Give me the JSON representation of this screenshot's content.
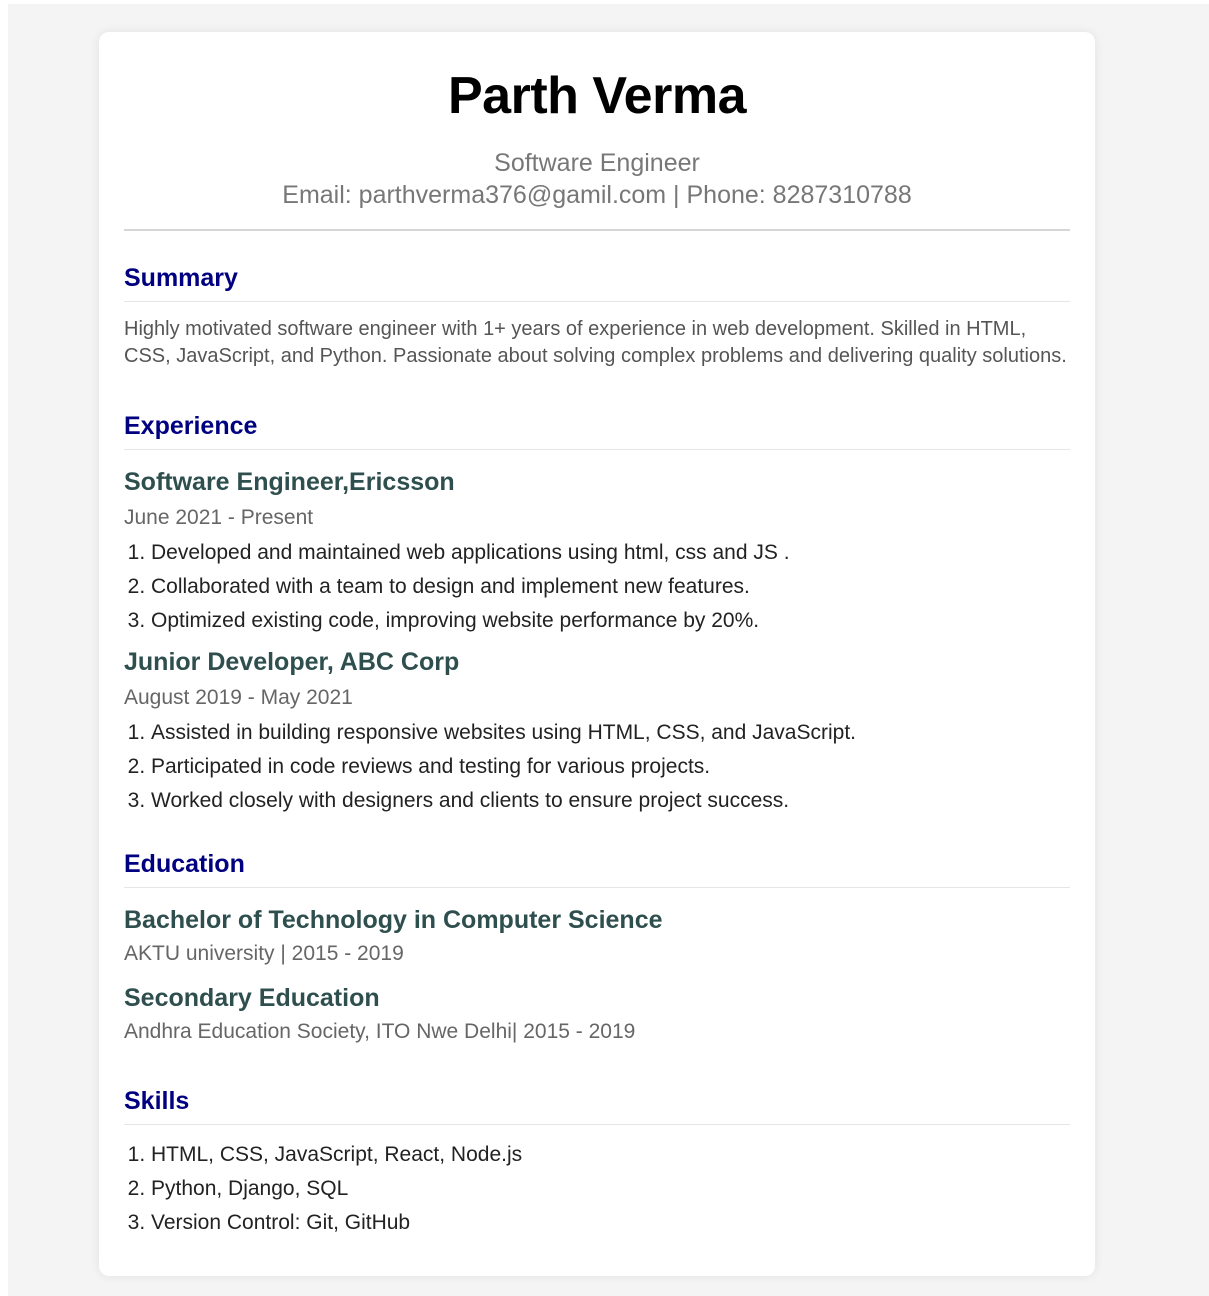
{
  "header": {
    "name": "Parth Verma",
    "role": "Software Engineer",
    "contact": "Email: parthverma376@gamil.com | Phone: 8287310788"
  },
  "summary": {
    "title": "Summary",
    "text": "Highly motivated software engineer with 1+ years of experience in web development. Skilled in HTML, CSS, JavaScript, and Python. Passionate about solving complex problems and delivering quality solutions."
  },
  "experience": {
    "title": "Experience",
    "jobs": [
      {
        "title": "Software Engineer,Ericsson",
        "dates": "June 2021 - Present",
        "items": [
          "Developed and maintained web applications using html, css and JS .",
          "Collaborated with a team to design and implement new features.",
          "Optimized existing code, improving website performance by 20%."
        ]
      },
      {
        "title": "Junior Developer, ABC Corp",
        "dates": "August 2019 - May 2021",
        "items": [
          "Assisted in building responsive websites using HTML, CSS, and JavaScript.",
          "Participated in code reviews and testing for various projects.",
          "Worked closely with designers and clients to ensure project success."
        ]
      }
    ]
  },
  "education": {
    "title": "Education",
    "entries": [
      {
        "title": "Bachelor of Technology in Computer Science",
        "detail": "AKTU university | 2015 - 2019"
      },
      {
        "title": "Secondary Education",
        "detail": "Andhra Education Society, ITO Nwe Delhi| 2015 - 2019"
      }
    ]
  },
  "skills": {
    "title": "Skills",
    "items": [
      "HTML, CSS, JavaScript, React, Node.js",
      "Python, Django, SQL",
      "Version Control: Git, GitHub"
    ]
  },
  "colors": {
    "section_heading": "#000080",
    "item_heading": "#2f4f4f",
    "muted_text": "#777777",
    "page_background": "#f4f4f4",
    "card_background": "#ffffff"
  }
}
